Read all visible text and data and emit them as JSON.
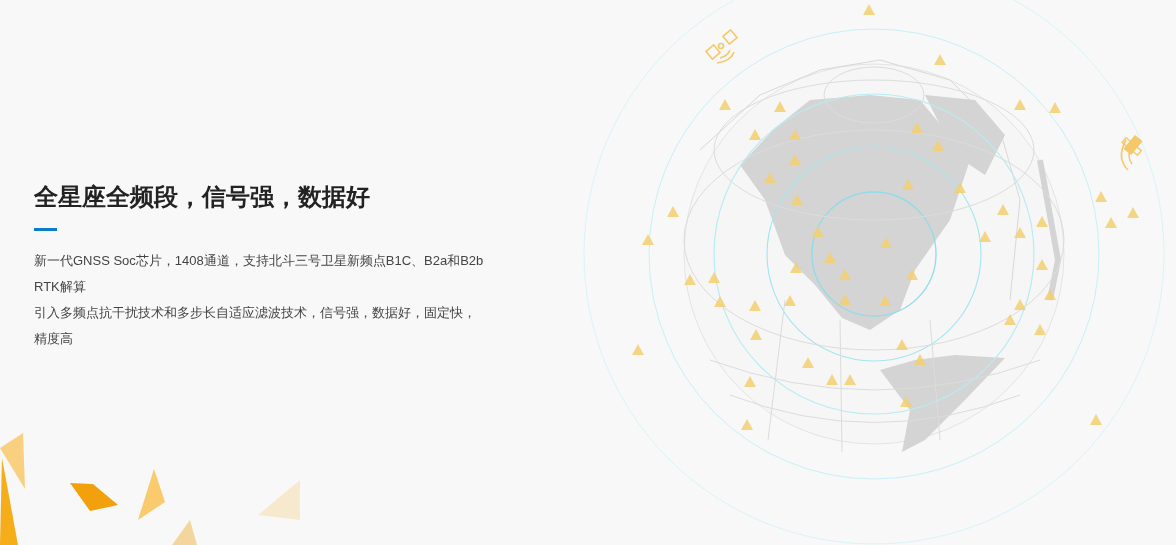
{
  "feature": {
    "title": "全星座全频段，信号强，数据好",
    "paragraphs": [
      "新一代GNSS Soc芯片，1408通道，支持北斗三号卫星新频点B1C、B2a和B2b RTK解算",
      "引入多频点抗干扰技术和多步长自适应滤波技术，信号强，数据好，固定快，精度高"
    ]
  }
}
